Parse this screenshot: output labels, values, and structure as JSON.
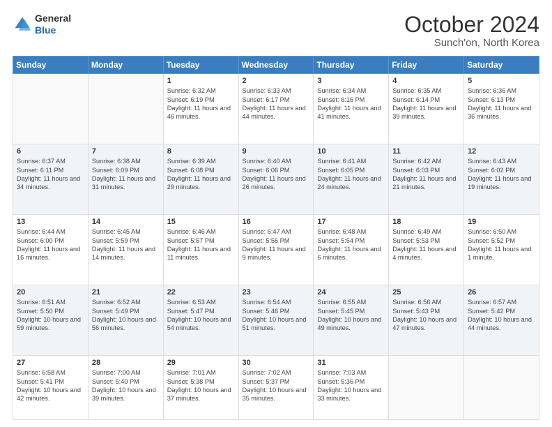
{
  "header": {
    "logo_line1": "General",
    "logo_line2": "Blue",
    "month": "October 2024",
    "location": "Sunch'on, North Korea"
  },
  "weekdays": [
    "Sunday",
    "Monday",
    "Tuesday",
    "Wednesday",
    "Thursday",
    "Friday",
    "Saturday"
  ],
  "weeks": [
    [
      {
        "day": "",
        "info": ""
      },
      {
        "day": "",
        "info": ""
      },
      {
        "day": "1",
        "info": "Sunrise: 6:32 AM\nSunset: 6:19 PM\nDaylight: 11 hours and 46 minutes."
      },
      {
        "day": "2",
        "info": "Sunrise: 6:33 AM\nSunset: 6:17 PM\nDaylight: 11 hours and 44 minutes."
      },
      {
        "day": "3",
        "info": "Sunrise: 6:34 AM\nSunset: 6:16 PM\nDaylight: 11 hours and 41 minutes."
      },
      {
        "day": "4",
        "info": "Sunrise: 6:35 AM\nSunset: 6:14 PM\nDaylight: 11 hours and 39 minutes."
      },
      {
        "day": "5",
        "info": "Sunrise: 6:36 AM\nSunset: 6:13 PM\nDaylight: 11 hours and 36 minutes."
      }
    ],
    [
      {
        "day": "6",
        "info": "Sunrise: 6:37 AM\nSunset: 6:11 PM\nDaylight: 11 hours and 34 minutes."
      },
      {
        "day": "7",
        "info": "Sunrise: 6:38 AM\nSunset: 6:09 PM\nDaylight: 11 hours and 31 minutes."
      },
      {
        "day": "8",
        "info": "Sunrise: 6:39 AM\nSunset: 6:08 PM\nDaylight: 11 hours and 29 minutes."
      },
      {
        "day": "9",
        "info": "Sunrise: 6:40 AM\nSunset: 6:06 PM\nDaylight: 11 hours and 26 minutes."
      },
      {
        "day": "10",
        "info": "Sunrise: 6:41 AM\nSunset: 6:05 PM\nDaylight: 11 hours and 24 minutes."
      },
      {
        "day": "11",
        "info": "Sunrise: 6:42 AM\nSunset: 6:03 PM\nDaylight: 11 hours and 21 minutes."
      },
      {
        "day": "12",
        "info": "Sunrise: 6:43 AM\nSunset: 6:02 PM\nDaylight: 11 hours and 19 minutes."
      }
    ],
    [
      {
        "day": "13",
        "info": "Sunrise: 6:44 AM\nSunset: 6:00 PM\nDaylight: 11 hours and 16 minutes."
      },
      {
        "day": "14",
        "info": "Sunrise: 6:45 AM\nSunset: 5:59 PM\nDaylight: 11 hours and 14 minutes."
      },
      {
        "day": "15",
        "info": "Sunrise: 6:46 AM\nSunset: 5:57 PM\nDaylight: 11 hours and 11 minutes."
      },
      {
        "day": "16",
        "info": "Sunrise: 6:47 AM\nSunset: 5:56 PM\nDaylight: 11 hours and 9 minutes."
      },
      {
        "day": "17",
        "info": "Sunrise: 6:48 AM\nSunset: 5:54 PM\nDaylight: 11 hours and 6 minutes."
      },
      {
        "day": "18",
        "info": "Sunrise: 6:49 AM\nSunset: 5:53 PM\nDaylight: 11 hours and 4 minutes."
      },
      {
        "day": "19",
        "info": "Sunrise: 6:50 AM\nSunset: 5:52 PM\nDaylight: 11 hours and 1 minute."
      }
    ],
    [
      {
        "day": "20",
        "info": "Sunrise: 6:51 AM\nSunset: 5:50 PM\nDaylight: 10 hours and 59 minutes."
      },
      {
        "day": "21",
        "info": "Sunrise: 6:52 AM\nSunset: 5:49 PM\nDaylight: 10 hours and 56 minutes."
      },
      {
        "day": "22",
        "info": "Sunrise: 6:53 AM\nSunset: 5:47 PM\nDaylight: 10 hours and 54 minutes."
      },
      {
        "day": "23",
        "info": "Sunrise: 6:54 AM\nSunset: 5:46 PM\nDaylight: 10 hours and 51 minutes."
      },
      {
        "day": "24",
        "info": "Sunrise: 6:55 AM\nSunset: 5:45 PM\nDaylight: 10 hours and 49 minutes."
      },
      {
        "day": "25",
        "info": "Sunrise: 6:56 AM\nSunset: 5:43 PM\nDaylight: 10 hours and 47 minutes."
      },
      {
        "day": "26",
        "info": "Sunrise: 6:57 AM\nSunset: 5:42 PM\nDaylight: 10 hours and 44 minutes."
      }
    ],
    [
      {
        "day": "27",
        "info": "Sunrise: 6:58 AM\nSunset: 5:41 PM\nDaylight: 10 hours and 42 minutes."
      },
      {
        "day": "28",
        "info": "Sunrise: 7:00 AM\nSunset: 5:40 PM\nDaylight: 10 hours and 39 minutes."
      },
      {
        "day": "29",
        "info": "Sunrise: 7:01 AM\nSunset: 5:38 PM\nDaylight: 10 hours and 37 minutes."
      },
      {
        "day": "30",
        "info": "Sunrise: 7:02 AM\nSunset: 5:37 PM\nDaylight: 10 hours and 35 minutes."
      },
      {
        "day": "31",
        "info": "Sunrise: 7:03 AM\nSunset: 5:36 PM\nDaylight: 10 hours and 33 minutes."
      },
      {
        "day": "",
        "info": ""
      },
      {
        "day": "",
        "info": ""
      }
    ]
  ]
}
